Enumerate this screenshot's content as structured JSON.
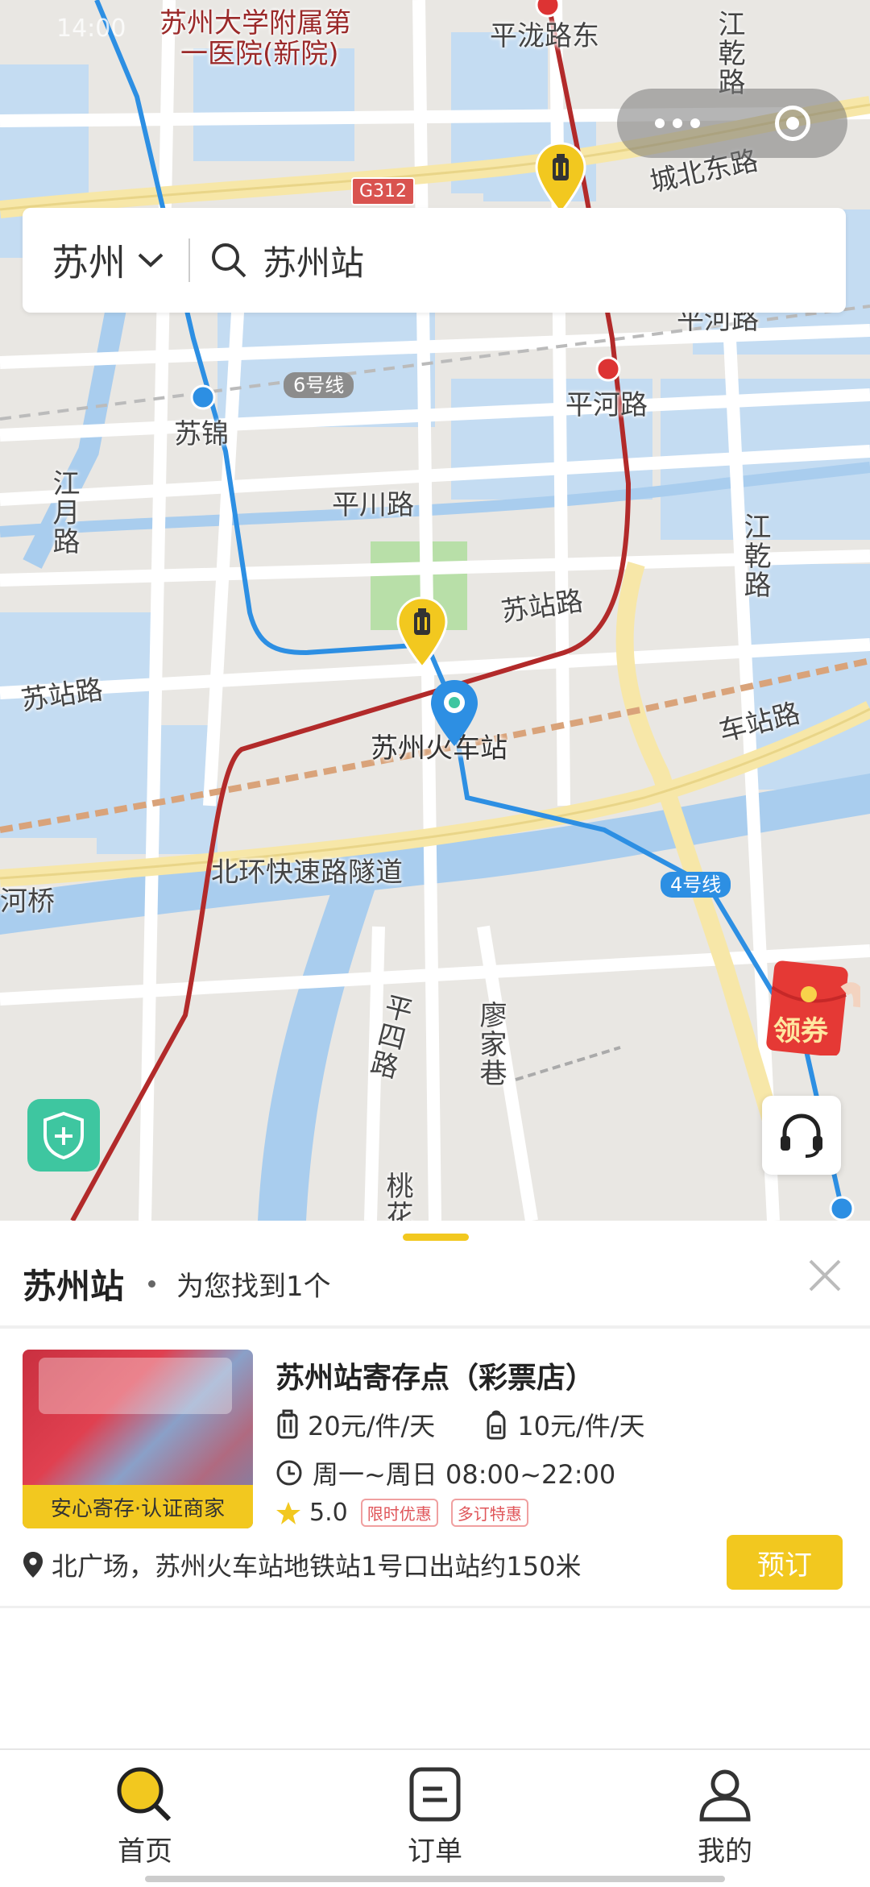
{
  "status_bar": {
    "time": "14:00"
  },
  "colors": {
    "accent": "#f2c81f",
    "metro_red": "#b22a2a",
    "metro_blue": "#2d8fe3",
    "shield_green": "#3ec6a0"
  },
  "map": {
    "labels": {
      "hospital_line1": "苏州大学附属第",
      "hospital_line2": "一医院(新院)",
      "pinglong_road_east": "平泷路东",
      "jiangqian_road_top": "江乾路",
      "chengbei_east_road": "城北东路",
      "g312": "G312",
      "pinghe_road_top": "平河路",
      "line6": "6号线",
      "pinghe_station": "平河路",
      "sujin": "苏锦",
      "jiangyue_road": "江月路",
      "pingchuan_road": "平川路",
      "jiangqian_road_mid": "江乾路",
      "suzhan_road_center": "苏站路",
      "suzhan_road_left": "苏站路",
      "che_zhan_road": "车站路",
      "suzhou_railway_station": "苏州火车站",
      "beihuan_tunnel": "北环快速路隧道",
      "he_bridge": "河桥",
      "line4": "4号线",
      "pingsi_road": "平四路",
      "liaojia_alley": "廖家巷",
      "taohua": "桃花"
    },
    "capsule": {
      "more_icon": "more-dots-icon",
      "close_icon": "target-circle-icon"
    },
    "coupon_label": "领券",
    "icons": {
      "shield": "shield-plus-icon",
      "support": "headset-icon",
      "luggage": "luggage-pin-icon",
      "location": "location-pin-icon"
    }
  },
  "search": {
    "city": "苏州",
    "query": "苏州站"
  },
  "sheet": {
    "title": "苏州站",
    "found_text": "为您找到1个",
    "store": {
      "name": "苏州站寄存点（彩票店）",
      "image_caption": "安心寄存·认证商家",
      "price_large": "20元/件/天",
      "price_small": "10元/件/天",
      "hours": "周一~周日 08:00~22:00",
      "rating": "5.0",
      "tag1": "限时优惠",
      "tag2": "多订特惠",
      "address": "北广场，苏州火车站地铁站1号口出站约150米",
      "book_label": "预订"
    }
  },
  "tabs": [
    {
      "label": "首页",
      "icon": "search-icon"
    },
    {
      "label": "订单",
      "icon": "order-list-icon"
    },
    {
      "label": "我的",
      "icon": "user-icon"
    }
  ]
}
